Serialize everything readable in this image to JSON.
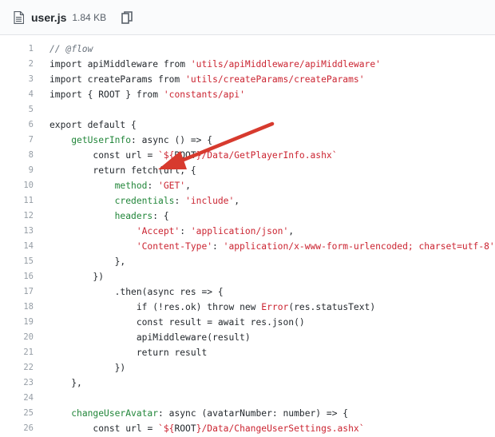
{
  "file": {
    "name": "user.js",
    "size": "1.84 KB",
    "icons": [
      "file-icon",
      "copy-icon"
    ]
  },
  "code_lines": [
    {
      "n": "1",
      "tokens": [
        {
          "c": "c",
          "t": "// @flow"
        }
      ]
    },
    {
      "n": "2",
      "tokens": [
        {
          "c": "k",
          "t": "import"
        },
        {
          "c": "src",
          "t": " apiMiddleware "
        },
        {
          "c": "k",
          "t": "from"
        },
        {
          "c": "src",
          "t": " "
        },
        {
          "c": "s",
          "t": "'utils/apiMiddleware/apiMiddleware'"
        }
      ]
    },
    {
      "n": "3",
      "tokens": [
        {
          "c": "k",
          "t": "import"
        },
        {
          "c": "src",
          "t": " createParams "
        },
        {
          "c": "k",
          "t": "from"
        },
        {
          "c": "src",
          "t": " "
        },
        {
          "c": "s",
          "t": "'utils/createParams/createParams'"
        }
      ]
    },
    {
      "n": "4",
      "tokens": [
        {
          "c": "k",
          "t": "import"
        },
        {
          "c": "src",
          "t": " { ROOT } "
        },
        {
          "c": "k",
          "t": "from"
        },
        {
          "c": "src",
          "t": " "
        },
        {
          "c": "s",
          "t": "'constants/api'"
        }
      ]
    },
    {
      "n": "5",
      "tokens": []
    },
    {
      "n": "6",
      "tokens": [
        {
          "c": "k",
          "t": "export default"
        },
        {
          "c": "src",
          "t": " {"
        }
      ]
    },
    {
      "n": "7",
      "tokens": [
        {
          "c": "src",
          "t": "    "
        },
        {
          "c": "g",
          "t": "getUserInfo"
        },
        {
          "c": "src",
          "t": ": "
        },
        {
          "c": "k",
          "t": "async"
        },
        {
          "c": "src",
          "t": " () => {"
        }
      ]
    },
    {
      "n": "8",
      "tokens": [
        {
          "c": "src",
          "t": "        "
        },
        {
          "c": "k",
          "t": "const"
        },
        {
          "c": "src",
          "t": " url = "
        },
        {
          "c": "s",
          "t": "`${"
        },
        {
          "c": "src",
          "t": "ROOT"
        },
        {
          "c": "s",
          "t": "}/Data/GetPlayerInfo.ashx`"
        }
      ]
    },
    {
      "n": "9",
      "tokens": [
        {
          "c": "src",
          "t": "        "
        },
        {
          "c": "k",
          "t": "return"
        },
        {
          "c": "src",
          "t": " fetch(url, {"
        }
      ]
    },
    {
      "n": "10",
      "tokens": [
        {
          "c": "src",
          "t": "            "
        },
        {
          "c": "g",
          "t": "method"
        },
        {
          "c": "src",
          "t": ": "
        },
        {
          "c": "s",
          "t": "'GET'"
        },
        {
          "c": "src",
          "t": ","
        }
      ]
    },
    {
      "n": "11",
      "tokens": [
        {
          "c": "src",
          "t": "            "
        },
        {
          "c": "g",
          "t": "credentials"
        },
        {
          "c": "src",
          "t": ": "
        },
        {
          "c": "s",
          "t": "'include'"
        },
        {
          "c": "src",
          "t": ","
        }
      ]
    },
    {
      "n": "12",
      "tokens": [
        {
          "c": "src",
          "t": "            "
        },
        {
          "c": "g",
          "t": "headers"
        },
        {
          "c": "src",
          "t": ": {"
        }
      ]
    },
    {
      "n": "13",
      "tokens": [
        {
          "c": "src",
          "t": "                "
        },
        {
          "c": "s",
          "t": "'Accept'"
        },
        {
          "c": "src",
          "t": ": "
        },
        {
          "c": "s",
          "t": "'application/json'"
        },
        {
          "c": "src",
          "t": ","
        }
      ]
    },
    {
      "n": "14",
      "tokens": [
        {
          "c": "src",
          "t": "                "
        },
        {
          "c": "s",
          "t": "'Content-Type'"
        },
        {
          "c": "src",
          "t": ": "
        },
        {
          "c": "s",
          "t": "'application/x-www-form-urlencoded; charset=utf-8'"
        },
        {
          "c": "src",
          "t": ","
        }
      ]
    },
    {
      "n": "15",
      "tokens": [
        {
          "c": "src",
          "t": "            },"
        }
      ]
    },
    {
      "n": "16",
      "tokens": [
        {
          "c": "src",
          "t": "        })"
        }
      ]
    },
    {
      "n": "17",
      "tokens": [
        {
          "c": "src",
          "t": "            .then("
        },
        {
          "c": "k",
          "t": "async"
        },
        {
          "c": "src",
          "t": " res => {"
        }
      ]
    },
    {
      "n": "18",
      "tokens": [
        {
          "c": "src",
          "t": "                "
        },
        {
          "c": "k",
          "t": "if"
        },
        {
          "c": "src",
          "t": " (!res.ok) "
        },
        {
          "c": "k",
          "t": "throw new"
        },
        {
          "c": "src",
          "t": " "
        },
        {
          "c": "s",
          "t": "Error"
        },
        {
          "c": "src",
          "t": "(res.statusText)"
        }
      ]
    },
    {
      "n": "19",
      "tokens": [
        {
          "c": "src",
          "t": "                "
        },
        {
          "c": "k",
          "t": "const"
        },
        {
          "c": "src",
          "t": " result = "
        },
        {
          "c": "k",
          "t": "await"
        },
        {
          "c": "src",
          "t": " res.json()"
        }
      ]
    },
    {
      "n": "20",
      "tokens": [
        {
          "c": "src",
          "t": "                apiMiddleware(result)"
        }
      ]
    },
    {
      "n": "21",
      "tokens": [
        {
          "c": "src",
          "t": "                "
        },
        {
          "c": "k",
          "t": "return"
        },
        {
          "c": "src",
          "t": " result"
        }
      ]
    },
    {
      "n": "22",
      "tokens": [
        {
          "c": "src",
          "t": "            })"
        }
      ]
    },
    {
      "n": "23",
      "tokens": [
        {
          "c": "src",
          "t": "    },"
        }
      ]
    },
    {
      "n": "24",
      "tokens": []
    },
    {
      "n": "25",
      "tokens": [
        {
          "c": "src",
          "t": "    "
        },
        {
          "c": "g",
          "t": "changeUserAvatar"
        },
        {
          "c": "src",
          "t": ": "
        },
        {
          "c": "k",
          "t": "async"
        },
        {
          "c": "src",
          "t": " (avatarNumber: number) => {"
        }
      ]
    },
    {
      "n": "26",
      "tokens": [
        {
          "c": "src",
          "t": "        "
        },
        {
          "c": "k",
          "t": "const"
        },
        {
          "c": "src",
          "t": " url = "
        },
        {
          "c": "s",
          "t": "`${"
        },
        {
          "c": "src",
          "t": "ROOT"
        },
        {
          "c": "s",
          "t": "}/Data/ChangeUserSettings.ashx`"
        }
      ]
    }
  ],
  "annotation": {
    "arrow_color": "#d73a2e"
  }
}
